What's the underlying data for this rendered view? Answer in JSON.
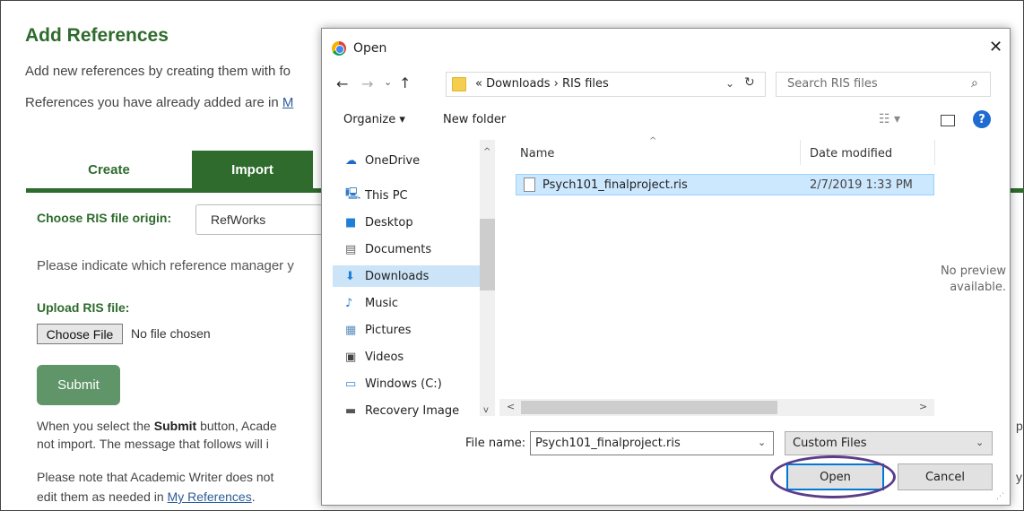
{
  "page": {
    "title": "Add References",
    "intro_line1": "Add new references by creating them with fo",
    "intro_line2_pre": "References you have already added are in ",
    "intro_line2_link": "M",
    "tabs": [
      {
        "label": "Create"
      },
      {
        "label": "Import"
      }
    ],
    "origin_label": "Choose RIS file origin:",
    "origin_value": "RefWorks",
    "indicate_text": "Please indicate which reference manager y",
    "upload_label": "Upload RIS file:",
    "choose_file_label": "Choose File",
    "no_file_text": "No file chosen",
    "submit_label": "Submit",
    "select_pre": "When you select the ",
    "select_bold": "Submit",
    "select_post": " button, Acade",
    "not_import_text": "not import. The message that follows will i",
    "note_text": "Please note that Academic Writer does not",
    "edit_pre": "edit them as needed in ",
    "edit_link": "My References",
    "edit_post": ".",
    "right_fragment_1": "p",
    "right_fragment_2": "y"
  },
  "dialog": {
    "title": "Open",
    "close_glyph": "✕",
    "nav": {
      "back": "←",
      "forward": "→",
      "recent": "⌄",
      "up": "↑"
    },
    "address": {
      "text": "«  Downloads  ›  RIS files",
      "dropdown_glyph": "⌄",
      "refresh_glyph": "↻"
    },
    "search": {
      "placeholder": "Search RIS files",
      "icon_glyph": "⌕"
    },
    "toolbar": {
      "organize_label": "Organize ▾",
      "new_folder_label": "New folder",
      "view_glyph": "☷ ▾",
      "help_glyph": "?"
    },
    "nav_pane": {
      "items": [
        {
          "label": "OneDrive",
          "icon": "☁"
        },
        {
          "label": "This PC",
          "icon": "🖳"
        },
        {
          "label": "Desktop",
          "icon": "■"
        },
        {
          "label": "Documents",
          "icon": "▤"
        },
        {
          "label": "Downloads",
          "icon": "⬇"
        },
        {
          "label": "Music",
          "icon": "♪"
        },
        {
          "label": "Pictures",
          "icon": "▦"
        },
        {
          "label": "Videos",
          "icon": "▣"
        },
        {
          "label": "Windows (C:)",
          "icon": "▭"
        },
        {
          "label": "Recovery Image",
          "icon": "▬"
        }
      ],
      "scroll_up_glyph": "^",
      "scroll_down_glyph": "v"
    },
    "columns": {
      "name": "Name",
      "date": "Date modified",
      "sort_glyph": "^"
    },
    "files": [
      {
        "name": "Psych101_finalproject.ris",
        "date": "2/7/2019 1:33 PM"
      }
    ],
    "preview_line1": "No preview",
    "preview_line2": "available.",
    "hscroll": {
      "left_glyph": "<",
      "right_glyph": ">"
    },
    "filename_label": "File name:",
    "filename_value": "Psych101_finalproject.ris",
    "filename_dropdown_glyph": "⌄",
    "filetype_value": "Custom Files",
    "filetype_dropdown_glyph": "⌄",
    "open_label": "Open",
    "cancel_label": "Cancel",
    "grip_glyph": "⋰",
    "colors": {
      "accent": "#0078d7",
      "selection": "#cce8ff",
      "highlight_ring": "#5b3c88"
    }
  }
}
